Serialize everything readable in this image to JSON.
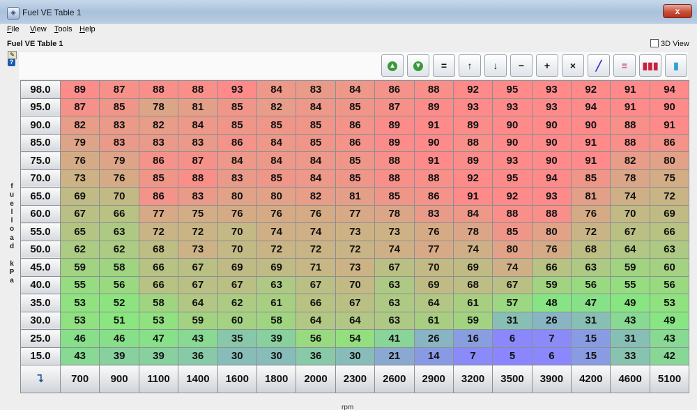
{
  "window": {
    "title": "Fuel VE Table 1",
    "close_glyph": "x"
  },
  "menu": [
    "File",
    "View",
    "Tools",
    "Help"
  ],
  "header": {
    "subtitle": "Fuel VE Table 1",
    "view3d_label": "3D View"
  },
  "toolbar": [
    {
      "name": "increase-green-button",
      "glyph": "▲",
      "color": "#3a9a3a"
    },
    {
      "name": "decrease-green-button",
      "glyph": "▼",
      "color": "#3a9a3a"
    },
    {
      "name": "equals-button",
      "glyph": "=",
      "color": "#111111"
    },
    {
      "name": "shift-up-button",
      "glyph": "↑",
      "color": "#111111"
    },
    {
      "name": "shift-down-button",
      "glyph": "↓",
      "color": "#111111"
    },
    {
      "name": "subtract-button",
      "glyph": "−",
      "color": "#111111"
    },
    {
      "name": "add-button",
      "glyph": "+",
      "color": "#111111"
    },
    {
      "name": "multiply-button",
      "glyph": "×",
      "color": "#111111"
    },
    {
      "name": "interpolate-button",
      "glyph": "╱",
      "color": "#3b2bd1"
    },
    {
      "name": "smooth-button",
      "glyph": "≡",
      "color": "#c41f6a"
    },
    {
      "name": "color-bars-button",
      "glyph": "▮▮▮",
      "color": "#cc1f3a"
    },
    {
      "name": "color-scale-button",
      "glyph": "▮",
      "color": "#2aa3d1"
    }
  ],
  "y_axis_label": "fuelload kPa",
  "y_axis_chars": [
    "f",
    "u",
    "e",
    "l",
    "l",
    "o",
    "a",
    "d",
    " ",
    "k",
    "P",
    "a"
  ],
  "x_axis_label": "rpm",
  "rpm": [
    "700",
    "900",
    "1100",
    "1400",
    "1600",
    "1800",
    "2000",
    "2300",
    "2600",
    "2900",
    "3200",
    "3500",
    "3900",
    "4200",
    "4600",
    "5100"
  ],
  "load": [
    "98.0",
    "95.0",
    "90.0",
    "85.0",
    "75.0",
    "70.0",
    "65.0",
    "60.0",
    "55.0",
    "50.0",
    "45.0",
    "40.0",
    "35.0",
    "30.0",
    "25.0",
    "15.0"
  ],
  "table": [
    [
      89,
      87,
      88,
      88,
      93,
      84,
      83,
      84,
      86,
      88,
      92,
      95,
      93,
      92,
      91,
      94
    ],
    [
      87,
      85,
      78,
      81,
      85,
      82,
      84,
      85,
      87,
      89,
      93,
      93,
      93,
      94,
      91,
      90
    ],
    [
      82,
      83,
      82,
      84,
      85,
      85,
      85,
      86,
      89,
      91,
      89,
      90,
      90,
      90,
      88,
      91
    ],
    [
      79,
      83,
      83,
      83,
      86,
      84,
      85,
      86,
      89,
      90,
      88,
      90,
      90,
      91,
      88,
      86
    ],
    [
      76,
      79,
      86,
      87,
      84,
      84,
      84,
      85,
      88,
      91,
      89,
      93,
      90,
      91,
      82,
      80
    ],
    [
      73,
      76,
      85,
      88,
      83,
      85,
      84,
      85,
      88,
      88,
      92,
      95,
      94,
      85,
      78,
      75
    ],
    [
      69,
      70,
      86,
      83,
      80,
      80,
      82,
      81,
      85,
      86,
      91,
      92,
      93,
      81,
      74,
      72
    ],
    [
      67,
      66,
      77,
      75,
      76,
      76,
      76,
      77,
      78,
      83,
      84,
      88,
      88,
      76,
      70,
      69
    ],
    [
      65,
      63,
      72,
      72,
      70,
      74,
      74,
      73,
      73,
      76,
      78,
      85,
      80,
      72,
      67,
      66
    ],
    [
      62,
      62,
      68,
      73,
      70,
      72,
      72,
      72,
      74,
      77,
      74,
      80,
      76,
      68,
      64,
      63
    ],
    [
      59,
      58,
      66,
      67,
      69,
      69,
      71,
      73,
      67,
      70,
      69,
      74,
      66,
      63,
      59,
      60
    ],
    [
      55,
      56,
      66,
      67,
      67,
      63,
      67,
      70,
      63,
      69,
      68,
      67,
      59,
      56,
      55,
      56
    ],
    [
      53,
      52,
      58,
      64,
      62,
      61,
      66,
      67,
      63,
      64,
      61,
      57,
      48,
      47,
      49,
      53
    ],
    [
      53,
      51,
      53,
      59,
      60,
      58,
      64,
      64,
      63,
      61,
      59,
      31,
      26,
      31,
      43,
      49
    ],
    [
      46,
      46,
      47,
      43,
      35,
      39,
      56,
      54,
      41,
      26,
      16,
      6,
      7,
      15,
      31,
      43
    ],
    [
      43,
      39,
      39,
      36,
      30,
      30,
      36,
      30,
      21,
      14,
      7,
      5,
      6,
      15,
      33,
      42
    ]
  ],
  "corner_icon": "axis-swap-icon",
  "colors": {
    "low": "#8a86ff",
    "mid": "#87e87f",
    "high": "#ff8a8a"
  }
}
